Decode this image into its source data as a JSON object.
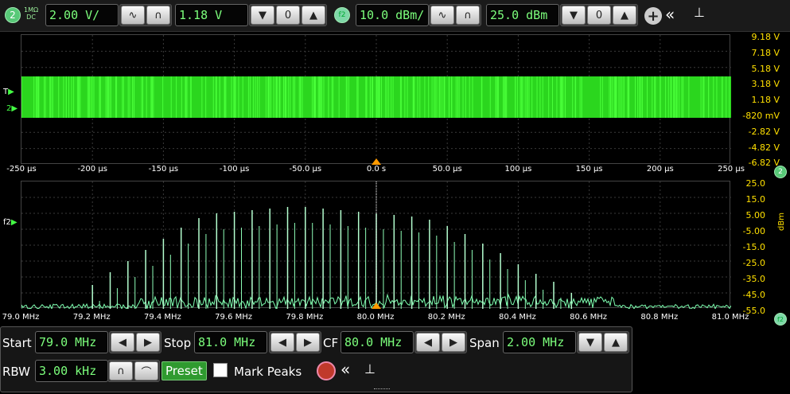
{
  "top": {
    "channel": "2",
    "coupling_top": "1MΩ",
    "coupling_bottom": "DC",
    "vscale": "2.00 V/",
    "offset": "1.18 V",
    "fn_badge": "f2",
    "dbm_scale": "10.0 dBm/",
    "ref_level": "25.0 dBm"
  },
  "time_plot": {
    "ticks_y": [
      "9.18 V",
      "7.18 V",
      "5.18 V",
      "3.18 V",
      "1.18 V",
      "-820 mV",
      "-2.82 V",
      "-4.82 V",
      "-6.82 V"
    ],
    "ticks_x": [
      "-250 µs",
      "-200 µs",
      "-150 µs",
      "-100 µs",
      "-50.0 µs",
      "0.0 s",
      "50.0 µs",
      "100 µs",
      "150 µs",
      "200 µs",
      "250 µs"
    ],
    "trigger_marker": "T",
    "ch_marker": "2",
    "ch_badge": "2"
  },
  "fft_plot": {
    "ticks_y": [
      "25.0",
      "15.0",
      "5.00",
      "-5.00",
      "-15.0",
      "-25.0",
      "-35.0",
      "-45.0",
      "-55.0"
    ],
    "ticks_x": [
      "79.0 MHz",
      "79.2 MHz",
      "79.4 MHz",
      "79.6 MHz",
      "79.8 MHz",
      "80.0 MHz",
      "80.2 MHz",
      "80.4 MHz",
      "80.6 MHz",
      "80.8 MHz",
      "81.0 MHz"
    ],
    "yunit": "dBm",
    "fn_marker": "f2",
    "fn_badge": "f2",
    "chart_data": {
      "type": "line",
      "title": "",
      "xlabel": "",
      "ylabel": "dBm",
      "xlim_mhz": [
        79.0,
        81.0
      ],
      "ylim_dbm": [
        -55,
        25
      ],
      "peaks_mhz": [
        79.55,
        79.6,
        79.65,
        79.7,
        79.75,
        79.8,
        79.85,
        79.9,
        79.95,
        80.0,
        80.05,
        80.1,
        80.15,
        80.2,
        80.25,
        80.3,
        80.35,
        80.4,
        80.45,
        79.5,
        79.45,
        79.4,
        79.35,
        79.3,
        79.25,
        79.2,
        80.5,
        80.55
      ],
      "peaks_dbm": [
        5,
        6,
        7,
        8,
        9,
        9,
        8,
        7,
        6,
        5,
        4,
        3,
        1,
        -3,
        -8,
        -14,
        -20,
        -27,
        -33,
        2,
        -4,
        -11,
        -18,
        -25,
        -32,
        -40,
        -38,
        -45
      ]
    }
  },
  "controls": {
    "start_label": "Start",
    "start_value": "79.0 MHz",
    "stop_label": "Stop",
    "stop_value": "81.0 MHz",
    "cf_label": "CF",
    "cf_value": "80.0 MHz",
    "span_label": "Span",
    "span_value": "2.00 MHz",
    "rbw_label": "RBW",
    "rbw_value": "3.00 kHz",
    "preset_label": "Preset",
    "mark_peaks_label": "Mark Peaks"
  }
}
